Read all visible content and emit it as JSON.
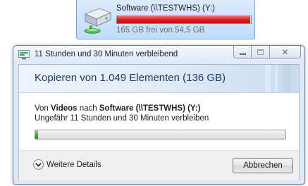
{
  "drive": {
    "name": "Software (\\\\TESTWHS) (Y:)",
    "free_text": "165 GB frei von 54,5 GB",
    "usage_fraction": 0.995,
    "bar_color": "#da1c1c",
    "icon": "network-drive-icon"
  },
  "dialog": {
    "title": "11 Stunden und 30 Minuten verbleibend",
    "title_icon": "copy-progress-icon",
    "caption_buttons": {
      "minimize": "minimize-button",
      "maximize": "maximize-button",
      "close": "close-button"
    },
    "heading": "Kopieren von 1.049 Elementen (136 GB)",
    "from_prefix": "Von",
    "from_source": "Videos",
    "from_mid": "nach",
    "from_target": "Software (\\\\TESTWHS) (Y:)",
    "time_remaining": "Ungefähr 11 Stunden und 30 Minuten verbleiben",
    "progress_fraction": 0.01,
    "progress_color": "#2fb62f",
    "details_label": "Weitere Details",
    "cancel_label": "Abbrechen"
  }
}
